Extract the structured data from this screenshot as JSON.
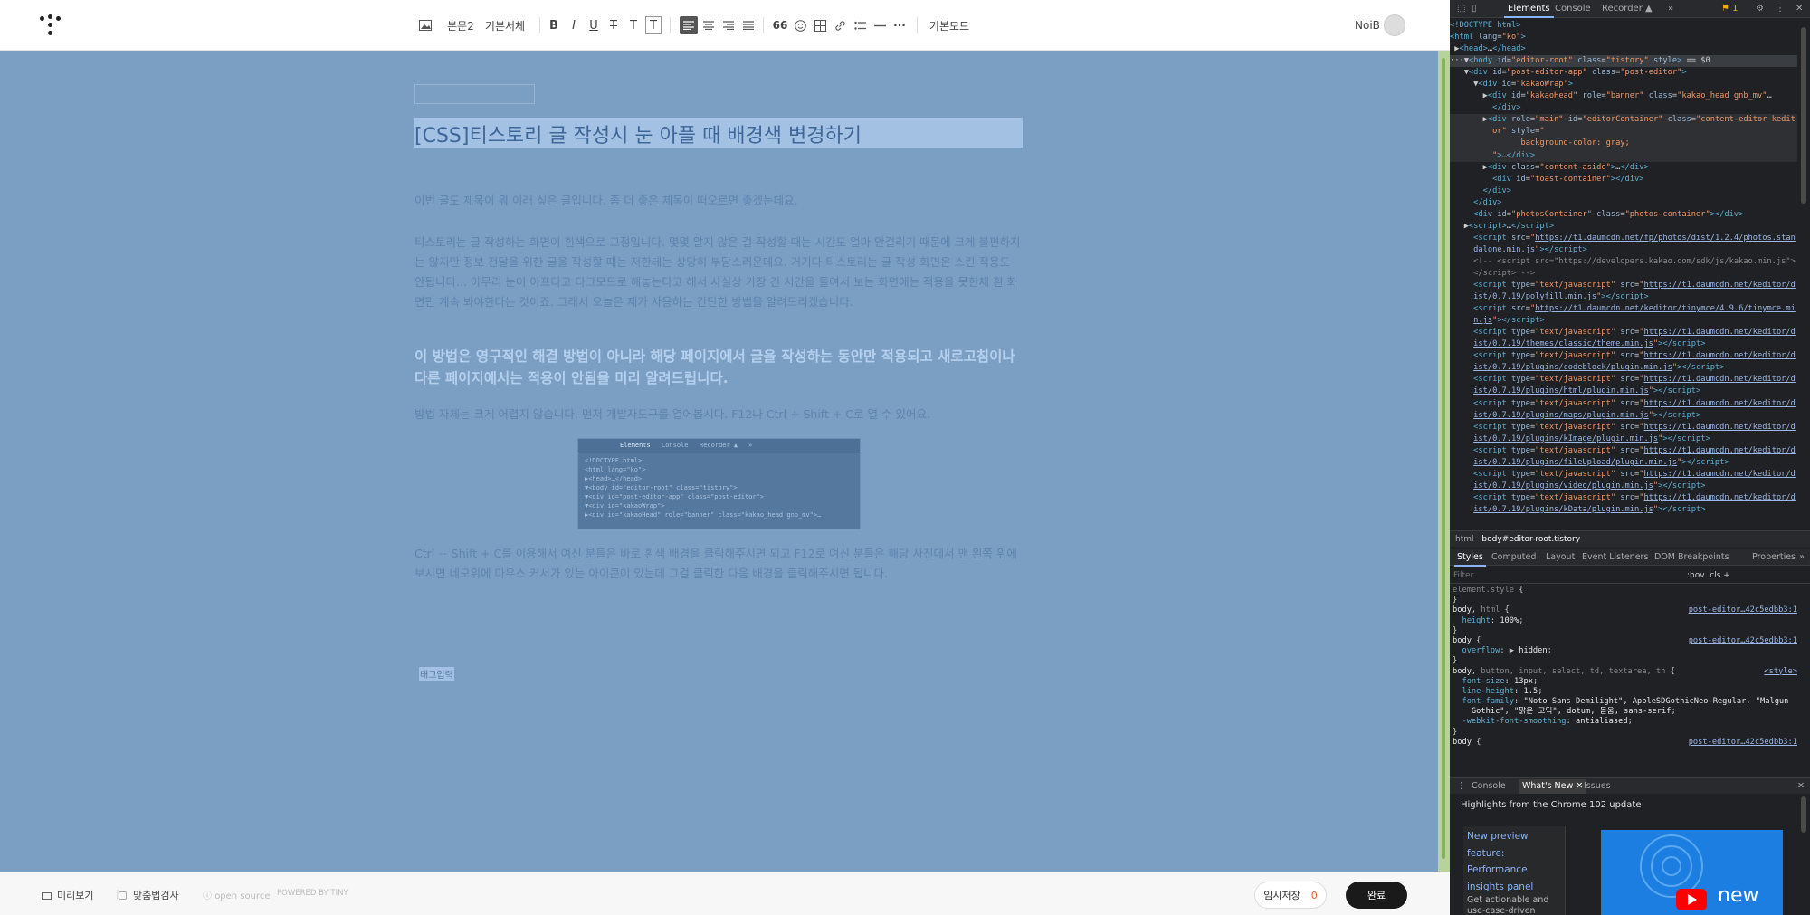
{
  "toolbar": {
    "image_label": "▣",
    "paragraph_style": "본문2",
    "font_family": "기본서체",
    "bold": "B",
    "italic": "I",
    "underline": "U",
    "strike": "T",
    "text_color": "T",
    "bg_color": "T",
    "quote": "66",
    "more": "···",
    "mode": "기본모드"
  },
  "user": {
    "name": "NoiB"
  },
  "editor": {
    "title": "[CSS]티스토리 글 작성시 눈 아플 때 배경색 변경하기",
    "paragraphs": [
      "이번 글도 제목이 뭐 이래 싶은 글입니다. 좀 더 좋은 제목이 떠오르면 좋겠는데요.",
      "티스토리는 글 작성하는 화면이 흰색으로 고정입니다. 몇몇 알지 않은 걸 작성할 때는 시간도 얼마 안걸리기 때문에 크게 불편하지는 않지만 정보 전달을 위한 글을 작성할 때는 저한테는 상당히 부담스러운데요. 거기다 티스토리는 글 작성 화면은 스킨 적용도 안됩니다... 아무리 눈이 아프다고 다크모드로 해놓는다고 해서 사실상 가장 긴 시간을 들여서 보는 화면에는 적용을 못한채 흰 화면만 계속 봐야한다는 것이죠. 그래서 오늘은 제가 사용하는 간단한 방법을 알려드리겠습니다.",
      "이 방법은 영구적인 해결 방법이 아니라 해당 페이지에서 글을 작성하는 동안만 적용되고 새로고침이나 다른 페이지에서는 적용이 안됨을 미리 알려드립니다.",
      "방법 자체는 크게 어렵지 않습니다. 먼저 개발자도구를 열어봅시다. F12나 Ctrl + Shift + C로 열 수 있어요.",
      "Ctrl + Shift + C를 이용해서 여신 분들은 바로 흰색 배경을 클릭해주시면 되고 F12로 여신 분들은 해당 사진에서 맨 왼쪽 위에 보시면 네모위에 마우스 커서가 있는 아이콘이 있는데 그걸 클릭한 다음 배경을 클릭해주시면 됩니다."
    ],
    "tag_input": "태그입력",
    "screenshot": {
      "tabs": [
        "Elements",
        "Console",
        "Recorder ▲",
        "»"
      ],
      "lines": [
        "<!DOCTYPE html>",
        "<html lang=\"ko\">",
        "▶<head>…</head>",
        "▼<body id=\"editor-root\" class=\"tistory\">",
        "  ▼<div id=\"post-editor-app\" class=\"post-editor\">",
        "    ▼<div id=\"kakaoWrap\">",
        "      ▶<div id=\"kakaoHead\" role=\"banner\" class=\"kakao_head gnb_mv\">…"
      ]
    },
    "bg_color": "#7b9ec3"
  },
  "footer": {
    "preview": "미리보기",
    "spellcheck": "맞춤법검사",
    "open_source": "open source",
    "powered_by": "POWERED BY TINY",
    "draft_label": "임시저장",
    "draft_count": "0",
    "done": "완료"
  },
  "devtools": {
    "tabs": [
      "Elements",
      "Console",
      "Recorder ▲",
      "»"
    ],
    "badge": "1",
    "dom_lines": [
      {
        "h": "<span class='tag'>&lt;!DOCTYPE html&gt;</span>"
      },
      {
        "h": "<span class='tag'>&lt;html</span> <span class='attr'>lang</span>=<span class='val'>\"ko\"</span><span class='tag'>&gt;</span>"
      },
      {
        "h": "&nbsp;▶<span class='tag'>&lt;head&gt;</span>…<span class='tag'>&lt;/head&gt;</span>"
      },
      {
        "h": "···▼<span class='tag'>&lt;body</span> <span class='attr'>id</span>=<span class='val'>\"editor-root\"</span> <span class='attr'>class</span>=<span class='val'>\"tistory\"</span> <span class='attr'>style</span><span class='tag'>&gt;</span> == $0",
        "sel": true
      },
      {
        "h": "&nbsp;&nbsp;&nbsp;▼<span class='tag'>&lt;div</span> <span class='attr'>id</span>=<span class='val'>\"post-editor-app\"</span> <span class='attr'>class</span>=<span class='val'>\"post-editor\"</span><span class='tag'>&gt;</span>"
      },
      {
        "h": "&nbsp;&nbsp;&nbsp;&nbsp;&nbsp;▼<span class='tag'>&lt;div</span> <span class='attr'>id</span>=<span class='val'>\"kakaoWrap\"</span><span class='tag'>&gt;</span>"
      },
      {
        "h": "&nbsp;&nbsp;&nbsp;&nbsp;&nbsp;&nbsp;&nbsp;▶<span class='tag'>&lt;div</span> <span class='attr'>id</span>=<span class='val'>\"kakaoHead\"</span> <span class='attr'>role</span>=<span class='val'>\"banner\"</span> <span class='attr'>class</span>=<span class='val'>\"kakao_head gnb_mv\"</span>…"
      },
      {
        "h": "&nbsp;&nbsp;&nbsp;&nbsp;&nbsp;&nbsp;&nbsp;&nbsp;&nbsp;<span class='tag'>&lt;/div&gt;</span>"
      },
      {
        "h": "&nbsp;&nbsp;&nbsp;&nbsp;&nbsp;&nbsp;&nbsp;▶<span class='tag'>&lt;div</span> <span class='attr'>role</span>=<span class='val'>\"main\"</span> <span class='attr'>id</span>=<span class='val'>\"editorContainer\"</span> <span class='attr'>class</span>=<span class='val'>\"content-editor kedit</span>",
        "hl": true
      },
      {
        "h": "&nbsp;&nbsp;&nbsp;&nbsp;&nbsp;&nbsp;&nbsp;&nbsp;&nbsp;<span class='val'>or\"</span> <span class='attr'>style</span>=<span class='val'>\"</span>",
        "hl": true
      },
      {
        "h": "&nbsp;&nbsp;&nbsp;&nbsp;&nbsp;&nbsp;&nbsp;&nbsp;&nbsp;&nbsp;&nbsp;&nbsp;&nbsp;&nbsp;&nbsp;<span class='val'>background-color: gray;</span>",
        "hl": true
      },
      {
        "h": "&nbsp;&nbsp;&nbsp;&nbsp;&nbsp;&nbsp;&nbsp;&nbsp;&nbsp;<span class='val'>\"</span><span class='tag'>&gt;</span>…<span class='tag'>&lt;/div&gt;</span>",
        "hl": true
      },
      {
        "h": "&nbsp;&nbsp;&nbsp;&nbsp;&nbsp;&nbsp;&nbsp;▶<span class='tag'>&lt;div</span> <span class='attr'>class</span>=<span class='val'>\"content-aside\"</span><span class='tag'>&gt;</span>…<span class='tag'>&lt;/div&gt;</span>"
      },
      {
        "h": "&nbsp;&nbsp;&nbsp;&nbsp;&nbsp;&nbsp;&nbsp;&nbsp;&nbsp;<span class='tag'>&lt;div</span> <span class='attr'>id</span>=<span class='val'>\"toast-container\"</span><span class='tag'>&gt;&lt;/div&gt;</span>"
      },
      {
        "h": "&nbsp;&nbsp;&nbsp;&nbsp;&nbsp;&nbsp;&nbsp;<span class='tag'>&lt;/div&gt;</span>"
      },
      {
        "h": "&nbsp;&nbsp;&nbsp;&nbsp;&nbsp;<span class='tag'>&lt;/div&gt;</span>"
      },
      {
        "h": "&nbsp;&nbsp;&nbsp;&nbsp;&nbsp;<span class='tag'>&lt;div</span> <span class='attr'>id</span>=<span class='val'>\"photosContainer\"</span> <span class='attr'>class</span>=<span class='val'>\"photos-container\"</span><span class='tag'>&gt;&lt;/div&gt;</span>"
      },
      {
        "h": "&nbsp;&nbsp;&nbsp;▶<span class='tag'>&lt;script&gt;</span>…<span class='tag'>&lt;/script&gt;</span>"
      },
      {
        "h": "&nbsp;&nbsp;&nbsp;&nbsp;&nbsp;<span class='tag'>&lt;script</span> <span class='attr'>src</span>=<span class='val'>\"</span><span class='lnk'>https://t1.daumcdn.net/fp/photos/dist/1.2.4/photos.stan</span>"
      },
      {
        "h": "&nbsp;&nbsp;&nbsp;&nbsp;&nbsp;<span class='lnk'>dalone.min.js</span><span class='val'>\"</span><span class='tag'>&gt;&lt;/script&gt;</span>"
      },
      {
        "h": "&nbsp;&nbsp;&nbsp;&nbsp;&nbsp;<span class='cm'>&lt;!-- &lt;script src=\"https://developers.kakao.com/sdk/js/kakao.min.js\"&gt;</span>"
      },
      {
        "h": "&nbsp;&nbsp;&nbsp;&nbsp;&nbsp;<span class='cm'>&lt;/script&gt; --&gt;</span>"
      },
      {
        "h": "&nbsp;&nbsp;&nbsp;&nbsp;&nbsp;<span class='tag'>&lt;script</span> <span class='attr'>type</span>=<span class='val'>\"text/javascript\"</span> <span class='attr'>src</span>=<span class='val'>\"</span><span class='lnk'>https://t1.daumcdn.net/keditor/d</span>"
      },
      {
        "h": "&nbsp;&nbsp;&nbsp;&nbsp;&nbsp;<span class='lnk'>ist/0.7.19/polyfill.min.js</span><span class='val'>\"</span><span class='tag'>&gt;&lt;/script&gt;</span>"
      },
      {
        "h": "&nbsp;&nbsp;&nbsp;&nbsp;&nbsp;<span class='tag'>&lt;script</span> <span class='attr'>src</span>=<span class='val'>\"</span><span class='lnk'>https://t1.daumcdn.net/keditor/tinymce/4.9.6/tinymce.mi</span>"
      },
      {
        "h": "&nbsp;&nbsp;&nbsp;&nbsp;&nbsp;<span class='lnk'>n.js</span><span class='val'>\"</span><span class='tag'>&gt;&lt;/script&gt;</span>"
      },
      {
        "h": "&nbsp;&nbsp;&nbsp;&nbsp;&nbsp;<span class='tag'>&lt;script</span> <span class='attr'>type</span>=<span class='val'>\"text/javascript\"</span> <span class='attr'>src</span>=<span class='val'>\"</span><span class='lnk'>https://t1.daumcdn.net/keditor/d</span>"
      },
      {
        "h": "&nbsp;&nbsp;&nbsp;&nbsp;&nbsp;<span class='lnk'>ist/0.7.19/themes/classic/theme.min.js</span><span class='val'>\"</span><span class='tag'>&gt;&lt;/script&gt;</span>"
      },
      {
        "h": "&nbsp;&nbsp;&nbsp;&nbsp;&nbsp;<span class='tag'>&lt;script</span> <span class='attr'>type</span>=<span class='val'>\"text/javascript\"</span> <span class='attr'>src</span>=<span class='val'>\"</span><span class='lnk'>https://t1.daumcdn.net/keditor/d</span>"
      },
      {
        "h": "&nbsp;&nbsp;&nbsp;&nbsp;&nbsp;<span class='lnk'>ist/0.7.19/plugins/codeblock/plugin.min.js</span><span class='val'>\"</span><span class='tag'>&gt;&lt;/script&gt;</span>"
      },
      {
        "h": "&nbsp;&nbsp;&nbsp;&nbsp;&nbsp;<span class='tag'>&lt;script</span> <span class='attr'>type</span>=<span class='val'>\"text/javascript\"</span> <span class='attr'>src</span>=<span class='val'>\"</span><span class='lnk'>https://t1.daumcdn.net/keditor/d</span>"
      },
      {
        "h": "&nbsp;&nbsp;&nbsp;&nbsp;&nbsp;<span class='lnk'>ist/0.7.19/plugins/html/plugin.min.js</span><span class='val'>\"</span><span class='tag'>&gt;&lt;/script&gt;</span>"
      },
      {
        "h": "&nbsp;&nbsp;&nbsp;&nbsp;&nbsp;<span class='tag'>&lt;script</span> <span class='attr'>type</span>=<span class='val'>\"text/javascript\"</span> <span class='attr'>src</span>=<span class='val'>\"</span><span class='lnk'>https://t1.daumcdn.net/keditor/d</span>"
      },
      {
        "h": "&nbsp;&nbsp;&nbsp;&nbsp;&nbsp;<span class='lnk'>ist/0.7.19/plugins/maps/plugin.min.js</span><span class='val'>\"</span><span class='tag'>&gt;&lt;/script&gt;</span>"
      },
      {
        "h": "&nbsp;&nbsp;&nbsp;&nbsp;&nbsp;<span class='tag'>&lt;script</span> <span class='attr'>type</span>=<span class='val'>\"text/javascript\"</span> <span class='attr'>src</span>=<span class='val'>\"</span><span class='lnk'>https://t1.daumcdn.net/keditor/d</span>"
      },
      {
        "h": "&nbsp;&nbsp;&nbsp;&nbsp;&nbsp;<span class='lnk'>ist/0.7.19/plugins/kImage/plugin.min.js</span><span class='val'>\"</span><span class='tag'>&gt;&lt;/script&gt;</span>"
      },
      {
        "h": "&nbsp;&nbsp;&nbsp;&nbsp;&nbsp;<span class='tag'>&lt;script</span> <span class='attr'>type</span>=<span class='val'>\"text/javascript\"</span> <span class='attr'>src</span>=<span class='val'>\"</span><span class='lnk'>https://t1.daumcdn.net/keditor/d</span>"
      },
      {
        "h": "&nbsp;&nbsp;&nbsp;&nbsp;&nbsp;<span class='lnk'>ist/0.7.19/plugins/fileUpload/plugin.min.js</span><span class='val'>\"</span><span class='tag'>&gt;&lt;/script&gt;</span>"
      },
      {
        "h": "&nbsp;&nbsp;&nbsp;&nbsp;&nbsp;<span class='tag'>&lt;script</span> <span class='attr'>type</span>=<span class='val'>\"text/javascript\"</span> <span class='attr'>src</span>=<span class='val'>\"</span><span class='lnk'>https://t1.daumcdn.net/keditor/d</span>"
      },
      {
        "h": "&nbsp;&nbsp;&nbsp;&nbsp;&nbsp;<span class='lnk'>ist/0.7.19/plugins/video/plugin.min.js</span><span class='val'>\"</span><span class='tag'>&gt;&lt;/script&gt;</span>"
      },
      {
        "h": "&nbsp;&nbsp;&nbsp;&nbsp;&nbsp;<span class='tag'>&lt;script</span> <span class='attr'>type</span>=<span class='val'>\"text/javascript\"</span> <span class='attr'>src</span>=<span class='val'>\"</span><span class='lnk'>https://t1.daumcdn.net/keditor/d</span>"
      },
      {
        "h": "&nbsp;&nbsp;&nbsp;&nbsp;&nbsp;<span class='lnk'>ist/0.7.19/plugins/kData/plugin.min.js</span><span class='val'>\"</span><span class='tag'>&gt;&lt;/script&gt;</span>"
      }
    ],
    "breadcrumb": [
      "html",
      "body#editor-root.tistory"
    ],
    "style_tabs": [
      "Styles",
      "Computed",
      "Layout",
      "Event Listeners",
      "DOM Breakpoints",
      "Properties",
      "»"
    ],
    "filter_placeholder": "Filter",
    "filter_tools": ":hov  .cls  +",
    "style_lines": [
      {
        "h": "<span class='cm'>element.style</span> {"
      },
      {
        "h": "}"
      },
      {
        "h": "<span class='pv'>body</span>, <span class='cm'>html</span> {",
        "src": "post-editor…42c5edbb3:1"
      },
      {
        "h": "&nbsp;&nbsp;<span class='prop'>height</span>: <span class='pv'>100%</span>;"
      },
      {
        "h": "}"
      },
      {
        "h": "<span class='pv'>body</span> {",
        "src": "post-editor…42c5edbb3:1"
      },
      {
        "h": "&nbsp;&nbsp;<span class='prop'>overflow</span>: ▶ <span class='pv'>hidden</span>;"
      },
      {
        "h": "}"
      },
      {
        "h": "<span class='pv'>body</span>, <span class='cm'>button, input, select, td, textarea, th</span> {",
        "src": "&lt;style&gt;"
      },
      {
        "h": "&nbsp;&nbsp;<span class='prop'>font-size</span>: <span class='pv'>13px</span>;"
      },
      {
        "h": "&nbsp;&nbsp;<span class='prop'>line-height</span>: <span class='pv'>1.5</span>;"
      },
      {
        "h": "&nbsp;&nbsp;<span class='prop'>font-family</span>: <span class='pv'>\"Noto Sans Demilight\", AppleSDGothicNeo-Regular, \"Malgun</span>"
      },
      {
        "h": "&nbsp;&nbsp;&nbsp;&nbsp;<span class='pv'>Gothic\", \"맑은 고딕\", dotum, 돋움, sans-serif</span>;"
      },
      {
        "h": "&nbsp;&nbsp;<span class='prop'>-webkit-font-smoothing</span>: <span class='pv'>antialiased</span>;"
      },
      {
        "h": "}"
      },
      {
        "h": "<span class='pv'>body</span> {",
        "src": "post-editor…42c5edbb3:1"
      }
    ],
    "drawer_tabs": [
      "Console",
      "What's New",
      "Issues"
    ],
    "whats_new_heading": "Highlights from the Chrome 102 update",
    "whats_new_links": [
      "New preview",
      "feature:",
      "Performance",
      "insights panel"
    ],
    "whats_new_desc": "Get actionable and use-case-driven",
    "whats_new_image_text": "new"
  }
}
